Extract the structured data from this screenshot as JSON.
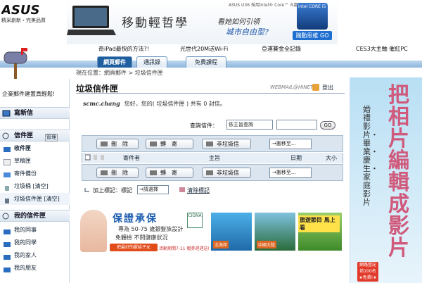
{
  "brand": {
    "logo": "ASUS",
    "tagline": "精采創新・完美品質"
  },
  "ad_banner": {
    "small_text": "ASUS U36 採用Intel® Core™ i5處理器",
    "slogan": "移動輕哲學",
    "question": "看她如何引領",
    "highlight": "城市自由型?",
    "intel_text": "intel CORE i5",
    "go_button": "踹動思維 GO"
  },
  "top_links": [
    "奇iPad最快的方法?!",
    "光世代20M送Wi-Fi",
    "亞運賽金全記錄",
    "CES3大主軸 催紅PC"
  ],
  "tabs": [
    {
      "label": "網頁郵件"
    },
    {
      "label": "通訊錄"
    },
    {
      "label": "免費課程"
    }
  ],
  "breadcrumb": "現在位置：網頁郵件 > 垃圾信件匣",
  "sidebar": {
    "promo": "企業郵件建置真輕鬆!",
    "compose": "寫新信",
    "inbox_header": "信件匣",
    "manage": "管理",
    "items": [
      "收件匣",
      "草稿匣",
      "寄件備份",
      "垃圾桶 [清空]",
      "垃圾信件匣 [清空]"
    ],
    "my_folders_header": "我的信件匣",
    "my_folders": [
      "我的同事",
      "我的同學",
      "我的家人",
      "我的朋友"
    ]
  },
  "main": {
    "title": "垃圾信件匣",
    "webmail_logo": "WEBMAIL@HINET",
    "logout": "登出",
    "greeting_user": "scmc.chang",
    "greeting_text": "您好，您的( 垃圾信件匣 ) 共有 0 封信。",
    "search_label": "查詢信件：",
    "search_select": "依主旨查詢",
    "search_go": "GO",
    "toolbar": {
      "delete": "刪　除",
      "forward": "轉　寄",
      "not_spam": "非垃圾信",
      "move": "→搬移至..."
    },
    "columns": {
      "sender": "寄件者",
      "subject": "主旨",
      "date": "日期",
      "size": "大小"
    },
    "tag_label": "加上標記：標記",
    "tag_select": "→請選擇",
    "clear_tags": "清除標記"
  },
  "bottom_ad": {
    "brand": "保證承保",
    "line1": "專為 50-75 歲銀髮族設計",
    "line2": "免體檢 不問健康狀況",
    "button": "把最好的獻給子女",
    "deadline": "活動期間7-11 贈券週週送!",
    "cigna": "CIGNA",
    "photo1": "北海岸",
    "photo2": "中國大陸",
    "tour": "旅遊節目 馬上看"
  },
  "right_ad": {
    "big": "把相片編輯成影片",
    "small": "婚禮影片・畢業・慶生・家庭影片",
    "signup": "網路登記 前100名 ★免費!★"
  }
}
